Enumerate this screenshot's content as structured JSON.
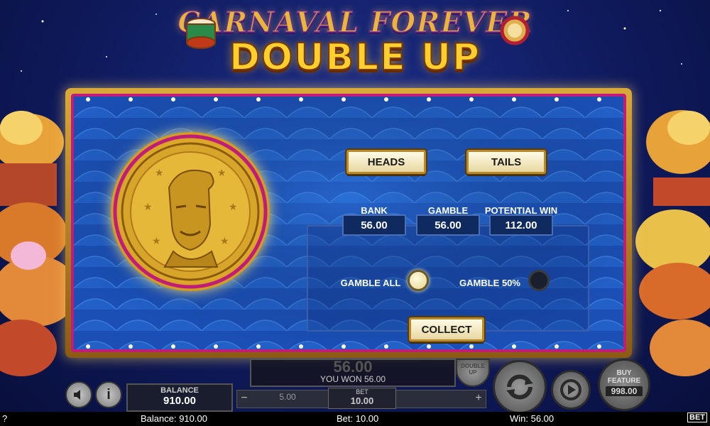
{
  "header": {
    "title": "CARNAVAL FOREVER",
    "subtitle": "DOUBLE UP"
  },
  "double_up": {
    "heads_label": "HEADS",
    "tails_label": "TAILS",
    "bank_label": "BANK",
    "bank_value": "56.00",
    "gamble_label": "GAMBLE",
    "gamble_value": "56.00",
    "potential_label": "POTENTIAL WIN",
    "potential_value": "112.00",
    "gamble_all_label": "GAMBLE ALL",
    "gamble_half_label": "GAMBLE 50%",
    "collect_label": "COLLECT",
    "selected_option": "gamble_all"
  },
  "hud": {
    "balance_label": "BALANCE",
    "balance_value": "910.00",
    "win_big": "56.00",
    "you_won": "YOU WON 56.00",
    "bet_label": "BET",
    "bet_value": "10.00",
    "bet_prev": "5.00",
    "double_up_label": "DOUBLE UP",
    "buy_feature_label": "BUY FEATURE",
    "buy_feature_value": "998.00",
    "sound_icon": "speaker-icon",
    "info_icon": "info-icon"
  },
  "status_bar": {
    "help": "?",
    "balance": "Balance: 910.00",
    "bet": "Bet: 10.00",
    "win": "Win: 56.00",
    "logo": "BET"
  },
  "colors": {
    "accent_gold": "#ffcf2e",
    "frame_magenta": "#c01c7a",
    "panel_blue": "#1b4fb5"
  }
}
